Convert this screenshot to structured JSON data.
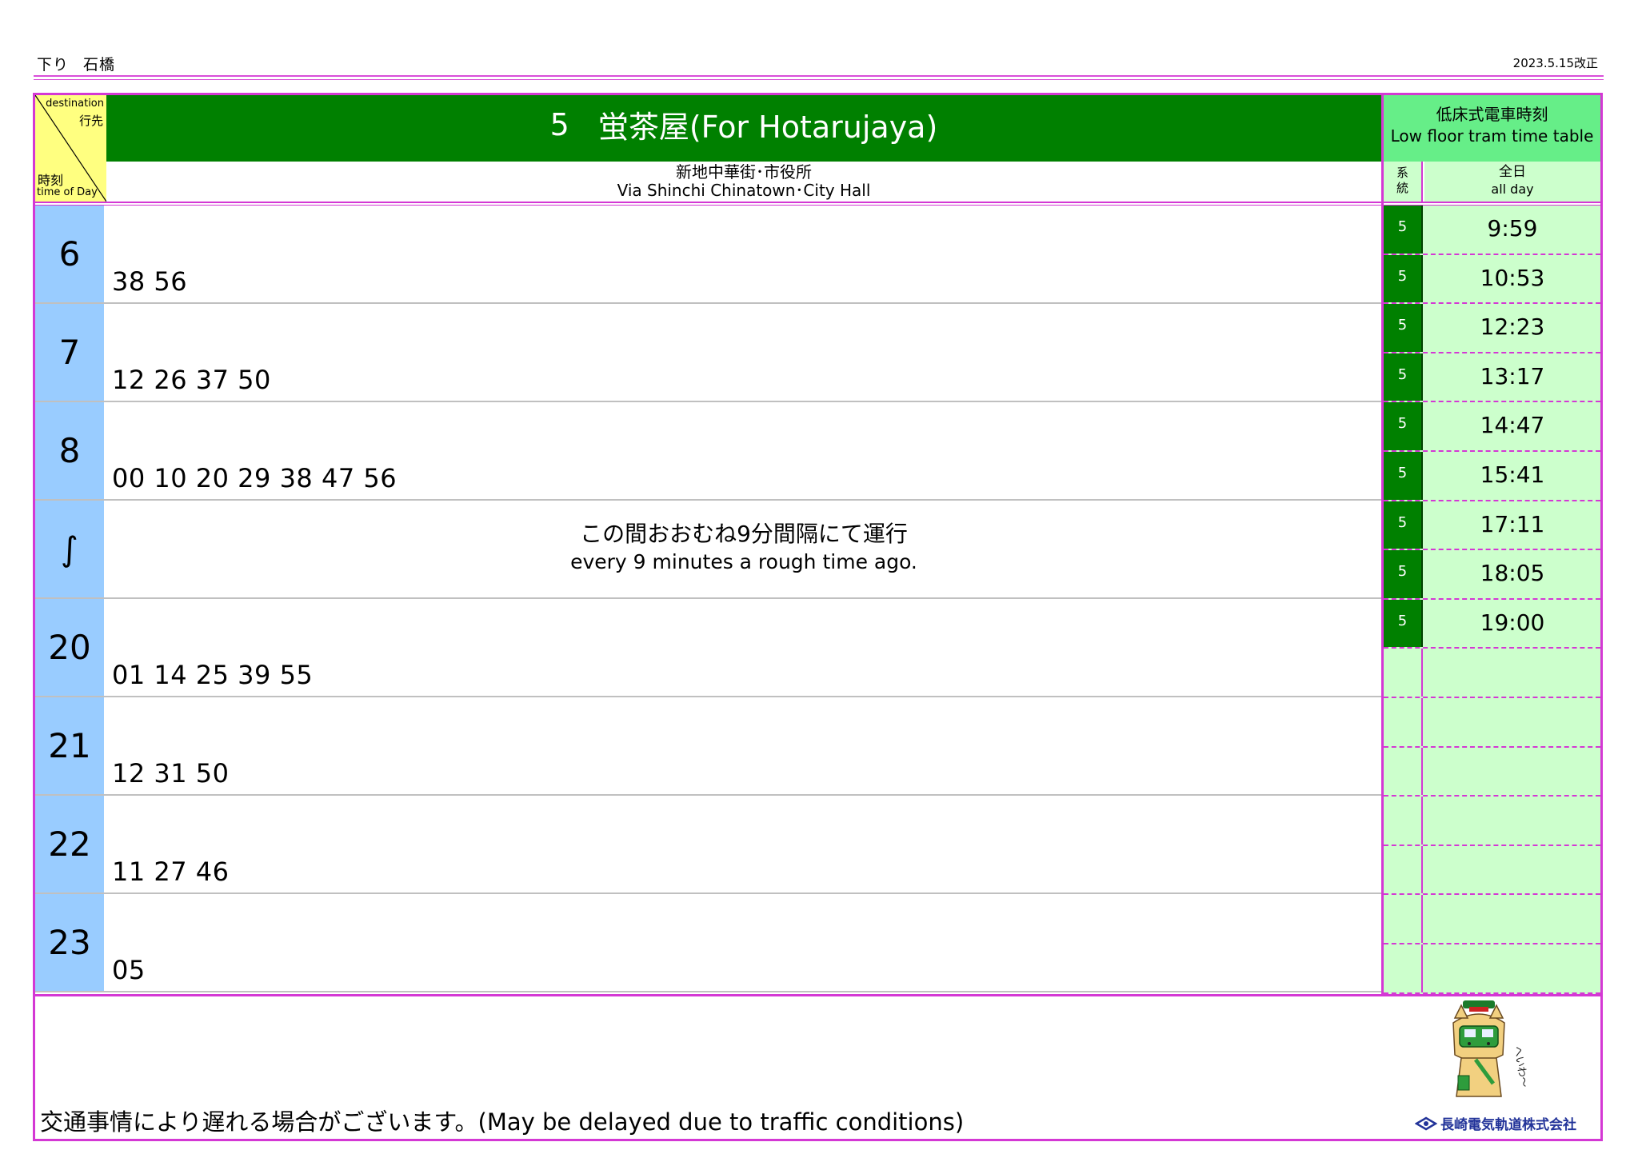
{
  "header": {
    "direction": "下り",
    "stop_name": "石橋",
    "revision": "2023.5.15改正"
  },
  "corner": {
    "destination_en": "destination",
    "destination_jp": "行先",
    "time_of_day_jp": "時刻",
    "time_of_day_en": "time of Day"
  },
  "route": {
    "number": "5",
    "destination": "蛍茶屋(For Hotarujaya)",
    "via_jp": "新地中華街･市役所",
    "via_en": "Via Shinchi Chinatown･City Hall"
  },
  "colors": {
    "accent_border": "#d438d4",
    "route_green": "#008000",
    "hour_blue": "#99ccff",
    "corner_yellow": "#ffff80",
    "low_floor_header": "#66ee88",
    "low_floor_bg": "#ccffcc"
  },
  "hours": [
    {
      "hour": "6",
      "minutes": "38 56"
    },
    {
      "hour": "7",
      "minutes": "12 26 37 50"
    },
    {
      "hour": "8",
      "minutes": "00 10 20 29 38 47 56"
    },
    {
      "hour": "∫",
      "minutes": ""
    },
    {
      "hour": "20",
      "minutes": "01 14 25 39 55"
    },
    {
      "hour": "21",
      "minutes": "12 31 50"
    },
    {
      "hour": "22",
      "minutes": "11 27 46"
    },
    {
      "hour": "23",
      "minutes": "05"
    }
  ],
  "interval_note": {
    "jp": "この間おおむね9分間隔にて運行",
    "en": "every 9 minutes a rough time ago."
  },
  "low_floor": {
    "title_jp": "低床式電車時刻",
    "title_en": "Low floor tram time table",
    "col_system": "系統",
    "col_allday_jp": "全日",
    "col_allday_en": "all day",
    "times": [
      {
        "route": "5",
        "time": "9:59"
      },
      {
        "route": "5",
        "time": "10:53"
      },
      {
        "route": "5",
        "time": "12:23"
      },
      {
        "route": "5",
        "time": "13:17"
      },
      {
        "route": "5",
        "time": "14:47"
      },
      {
        "route": "5",
        "time": "15:41"
      },
      {
        "route": "5",
        "time": "17:11"
      },
      {
        "route": "5",
        "time": "18:05"
      },
      {
        "route": "5",
        "time": "19:00"
      },
      {
        "route": "",
        "time": ""
      },
      {
        "route": "",
        "time": ""
      },
      {
        "route": "",
        "time": ""
      },
      {
        "route": "",
        "time": ""
      },
      {
        "route": "",
        "time": ""
      },
      {
        "route": "",
        "time": ""
      },
      {
        "route": "",
        "time": ""
      }
    ]
  },
  "footer": {
    "note": "交通事情により遅れる場合がございます。(May be delayed due to traffic conditions)",
    "company": "長崎電気軌道株式会社",
    "mascot_caption": "へいわ〜"
  }
}
